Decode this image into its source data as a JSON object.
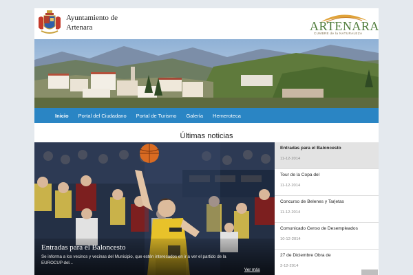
{
  "header": {
    "title_line1": "Ayuntamiento de",
    "title_line2": "Artenara",
    "brand_name": "ARTENARA",
    "brand_tagline": "CUMBRE de la NATURALEZA",
    "crest_icon": "coat-of-arms-icon",
    "brand_color": "#4e7b3a"
  },
  "nav": {
    "color": "#2a85c4",
    "items": [
      {
        "label": "Inicio"
      },
      {
        "label": "Portal del Ciudadano"
      },
      {
        "label": "Portal de Turismo"
      },
      {
        "label": "Galería"
      },
      {
        "label": "Hemeroteca"
      }
    ]
  },
  "news": {
    "section_title": "Últimas noticias",
    "featured": {
      "title": "Entradas para el Baloncesto",
      "description": "Se informa a los vecinos y vecinas del Municipio, que estén interesados en ir a ver el partido de la EUROCUP del...",
      "more_label": "Ver más",
      "image": "basketball-player-photo"
    },
    "items": [
      {
        "title": "Entradas para el Baloncesto",
        "date": "11-12-2014"
      },
      {
        "title": "Tour de la Copa del",
        "date": "11-12-2014"
      },
      {
        "title": "Concurso de Belenes y Tarjetas",
        "date": "11-12-2014"
      },
      {
        "title": "Comunicado Censo de Desempleados",
        "date": "10-12-2014"
      },
      {
        "title": "27 de Diciembre Obra de",
        "date": "3-12-2014"
      }
    ]
  }
}
